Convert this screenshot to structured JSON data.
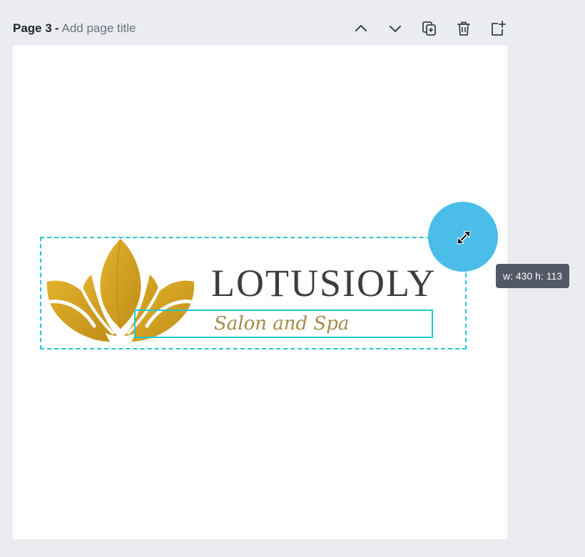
{
  "header": {
    "page_label": "Page 3",
    "separator": "-",
    "title_placeholder": "Add page title"
  },
  "toolbar": {
    "items": [
      {
        "name": "move-page-up-button",
        "icon": "chevron-up-icon"
      },
      {
        "name": "move-page-down-button",
        "icon": "chevron-down-icon"
      },
      {
        "name": "duplicate-page-button",
        "icon": "duplicate-icon"
      },
      {
        "name": "delete-page-button",
        "icon": "trash-icon"
      },
      {
        "name": "add-page-button",
        "icon": "add-page-icon"
      }
    ]
  },
  "canvas": {
    "logo": {
      "brand_name": "LOTUSIOLY",
      "tagline": "Salon and Spa",
      "icon": "lotus-icon",
      "icon_color": "#d3a21f",
      "text_color": "#3d3d3d",
      "tagline_color": "#a68a4a"
    },
    "selection_color": "#1fc7d1",
    "resize_tooltip": "w: 430 h: 113",
    "handle_color": "#40b9e8"
  }
}
